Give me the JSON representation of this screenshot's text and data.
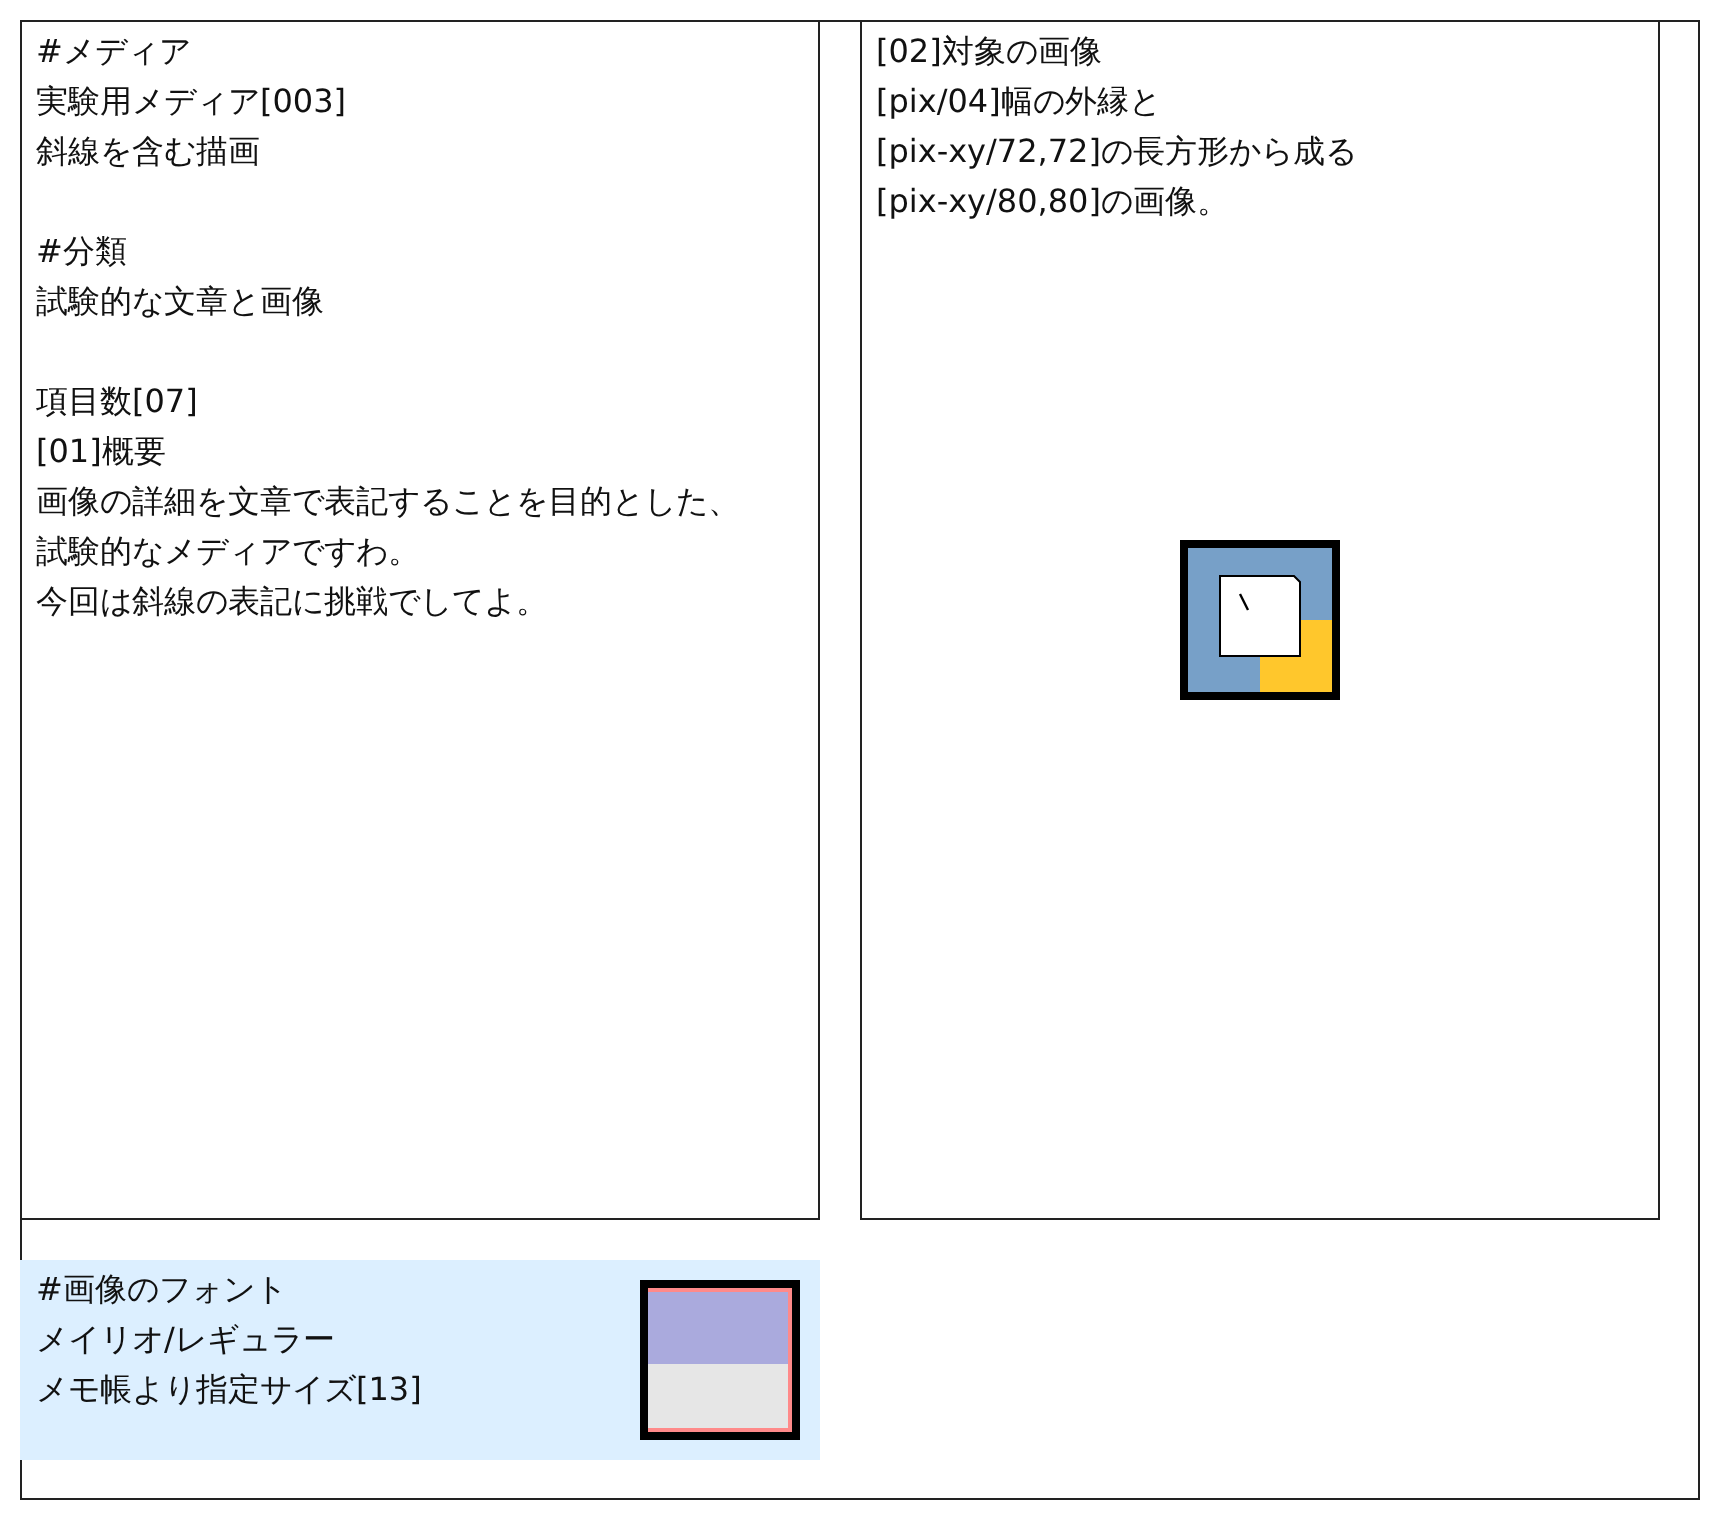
{
  "media_panel": {
    "groups": [
      {
        "lines": [
          "#メディア",
          "実験用メディア[003]",
          "斜線を含む描画"
        ]
      },
      {
        "lines": [
          "#分類",
          "試験的な文章と画像"
        ]
      },
      {
        "lines": [
          "項目数[07]",
          "[01]概要",
          "画像の詳細を文章で表記することを目的とした、",
          "試験的なメディアですわ。",
          "今回は斜線の表記に挑戦でしてよ。"
        ]
      }
    ]
  },
  "image_panel": {
    "lines": [
      "[02]対象の画像",
      "[pix/04]幅の外縁と",
      "[pix-xy/72,72]の長方形から成る",
      "[pix-xy/80,80]の画像。"
    ]
  },
  "font_panel": {
    "lines": [
      "#画像のフォント",
      "メイリオ/レギュラー",
      "メモ帳より指定サイズ[13]"
    ]
  }
}
